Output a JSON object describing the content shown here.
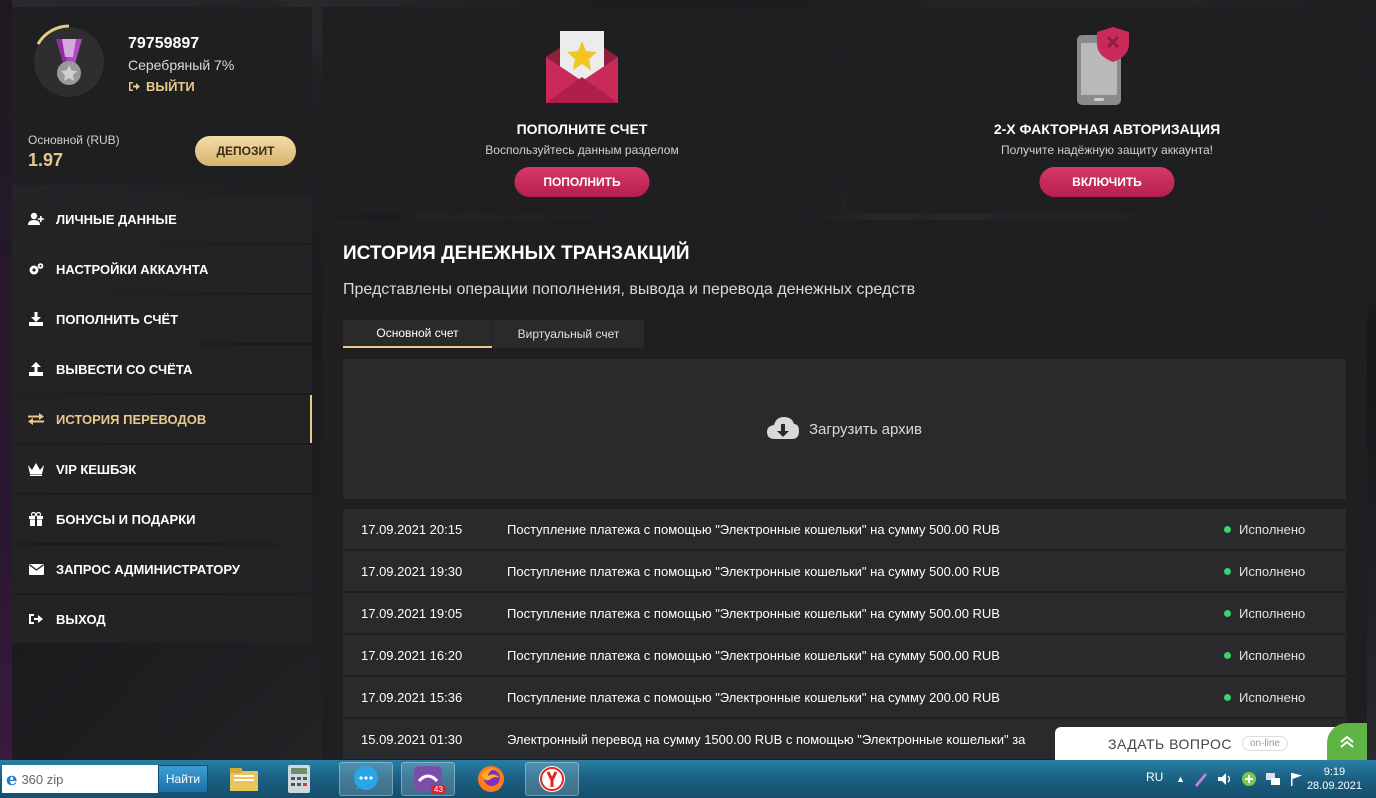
{
  "profile": {
    "user_id": "79759897",
    "level": "Серебряный 7%",
    "logout_label": "ВЫЙТИ",
    "balance_label": "Основной (RUB)",
    "balance_value": "1.97",
    "deposit_label": "ДЕПОЗИТ"
  },
  "menu": {
    "items": [
      {
        "label": "ЛИЧНЫЕ ДАННЫЕ",
        "icon": "user-plus-icon"
      },
      {
        "label": "НАСТРОЙКИ АККАУНТА",
        "icon": "gears-icon"
      },
      {
        "label": "ПОПОЛНИТЬ СЧЁТ",
        "icon": "download-icon"
      },
      {
        "label": "ВЫВЕСТИ СО СЧЁТА",
        "icon": "upload-icon"
      },
      {
        "label": "ИСТОРИЯ ПЕРЕВОДОВ",
        "icon": "exchange-icon",
        "active": true
      },
      {
        "label": "VIP КЕШБЭК",
        "icon": "crown-icon"
      },
      {
        "label": "БОНУСЫ И ПОДАРКИ",
        "icon": "gift-icon"
      },
      {
        "label": "ЗАПРОС АДМИНИСТРАТОРУ",
        "icon": "envelope-icon"
      },
      {
        "label": "ВЫХОД",
        "icon": "sign-out-icon"
      }
    ]
  },
  "cards": {
    "topup": {
      "title": "ПОПОЛНИТЕ СЧЕТ",
      "subtitle": "Воспользуйтесь данным разделом",
      "button": "ПОПОЛНИТЬ"
    },
    "twofa": {
      "title": "2-Х ФАКТОРНАЯ АВТОРИЗАЦИЯ",
      "subtitle": "Получите надёжную защиту аккаунта!",
      "button": "ВКЛЮЧИТЬ"
    }
  },
  "history": {
    "title": "ИСТОРИЯ ДЕНЕЖНЫХ ТРАНЗАКЦИЙ",
    "subtitle": "Представлены операции пополнения, вывода и перевода денежных средств",
    "tabs": [
      "Основной счет",
      "Виртуальный счет"
    ],
    "archive_label": "Загрузить архив",
    "rows": [
      {
        "date": "17.09.2021 20:15",
        "desc": "Поступление платежа с помощью \"Электронные кошельки\" на сумму 500.00 RUB",
        "status": "Исполнено"
      },
      {
        "date": "17.09.2021 19:30",
        "desc": "Поступление платежа с помощью \"Электронные кошельки\" на сумму 500.00 RUB",
        "status": "Исполнено"
      },
      {
        "date": "17.09.2021 19:05",
        "desc": "Поступление платежа с помощью \"Электронные кошельки\" на сумму 500.00 RUB",
        "status": "Исполнено"
      },
      {
        "date": "17.09.2021 16:20",
        "desc": "Поступление платежа с помощью \"Электронные кошельки\" на сумму 500.00 RUB",
        "status": "Исполнено"
      },
      {
        "date": "17.09.2021 15:36",
        "desc": "Поступление платежа с помощью \"Электронные кошельки\" на сумму 200.00 RUB",
        "status": "Исполнено"
      },
      {
        "date": "15.09.2021 01:30",
        "desc": "Электронный перевод на сумму 1500.00 RUB с помощью \"Электронные кошельки\" за",
        "status": ""
      }
    ]
  },
  "ask_widget": {
    "label": "ЗАДАТЬ ВОПРОС",
    "online": "on-line"
  },
  "taskbar": {
    "search_value": "360 zip",
    "search_button": "Найти",
    "badge": "43",
    "lang": "RU",
    "time": "9:19",
    "date": "28.09.2021"
  },
  "colors": {
    "accent_gold": "#e7c98a",
    "accent_pink": "#c92a5a",
    "status_green": "#3ecf6e"
  }
}
